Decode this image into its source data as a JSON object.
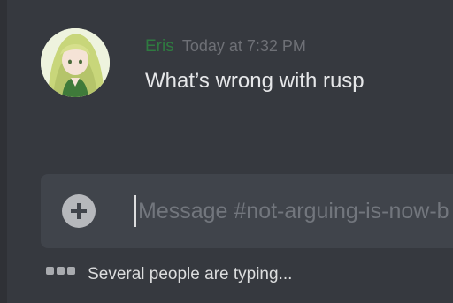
{
  "message": {
    "author": "Eris",
    "timestamp": "Today at 7:32 PM",
    "text": "What’s wrong with rusp",
    "avatar_icon": "anime-avatar-icon"
  },
  "composer": {
    "placeholder": "Message #not-arguing-is-now-b",
    "add_icon": "plus-circle-icon"
  },
  "typing_indicator": {
    "text": "Several people are typing..."
  },
  "colors": {
    "background": "#36393f",
    "composer_bg": "#40444b",
    "author": "#2f7a40",
    "timestamp": "#6e7076",
    "message_text": "#e6e7e9"
  }
}
